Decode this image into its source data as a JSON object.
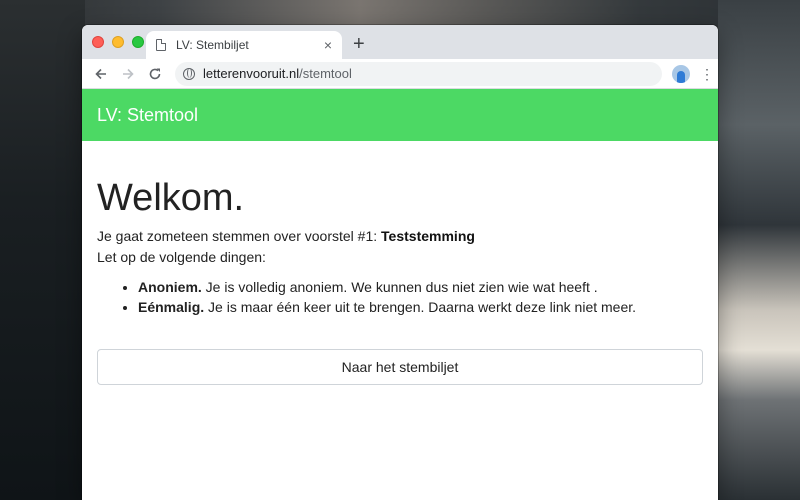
{
  "browser": {
    "tab_title": "LV: Stembiljet",
    "new_tab_symbol": "+",
    "close_symbol": "×",
    "url_host": "letterenvooruit.nl",
    "url_path": "/stemtool"
  },
  "app": {
    "title": "LV: Stemtool",
    "accent_color": "#4cd964"
  },
  "main": {
    "heading": "Welkom.",
    "intro_prefix": "Je gaat zometeen stemmen over voorstel #1: ",
    "proposal_name": "Teststemming",
    "notice": "Let op de volgende dingen:",
    "points": [
      {
        "label": "Anoniem.",
        "text": " Je is volledig anoniem. We kunnen dus niet zien wie wat heeft ."
      },
      {
        "label": "Eénmalig.",
        "text": " Je is maar één keer uit te brengen. Daarna werkt deze link niet meer."
      }
    ],
    "button_label": "Naar het stembiljet"
  },
  "icons": [
    "back-icon",
    "forward-icon",
    "reload-icon",
    "globe-icon",
    "profile-icon",
    "menu-icon",
    "page-icon",
    "close-icon",
    "new-tab-icon"
  ]
}
